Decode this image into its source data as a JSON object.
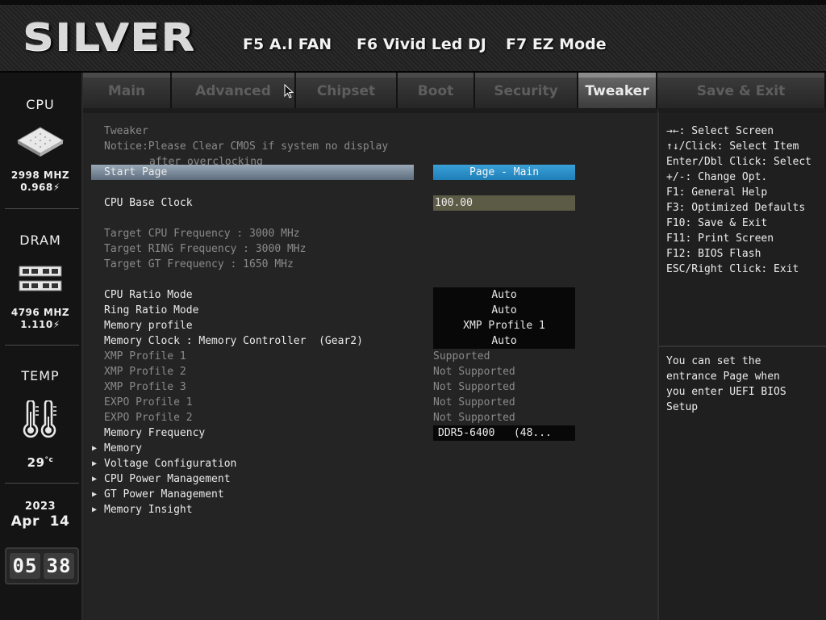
{
  "header": {
    "logo": "SILVER",
    "hotkeys": [
      {
        "label": "F5 A.I FAN"
      },
      {
        "label": "F6 Vivid Led DJ"
      },
      {
        "label": "F7 EZ Mode"
      }
    ]
  },
  "sidebar": {
    "cpu": {
      "title": "CPU",
      "freq": "2998 MHZ",
      "volt": "0.968",
      "icon": "cpu-chip-icon"
    },
    "dram": {
      "title": "DRAM",
      "freq": "4796 MHZ",
      "volt": "1.110",
      "icon": "dram-module-icon"
    },
    "temp": {
      "title": "TEMP",
      "value": "29",
      "icon": "thermometer-icon"
    },
    "date": {
      "year": "2023",
      "month_day": "Apr  14"
    },
    "clock": {
      "hours": "05",
      "minutes": "38"
    }
  },
  "tabs": [
    {
      "label": "Main",
      "active": false
    },
    {
      "label": "Advanced",
      "active": false
    },
    {
      "label": "Chipset",
      "active": false
    },
    {
      "label": "Boot",
      "active": false
    },
    {
      "label": "Security",
      "active": false
    },
    {
      "label": "Tweaker",
      "active": true
    },
    {
      "label": "Save & Exit",
      "active": false
    }
  ],
  "main": {
    "section_title": "Tweaker",
    "notice_line1": "Notice:Please Clear CMOS if system no display",
    "notice_line2": "after overclocking",
    "start_page": {
      "label": "Start Page",
      "value": "Page - Main"
    },
    "cpu_base_clock": {
      "label": "CPU Base Clock",
      "value": "100.00"
    },
    "targets": [
      "Target CPU Frequency : 3000 MHz",
      "Target RING Frequency : 3000 MHz",
      "Target GT Frequency : 1650 MHz"
    ],
    "settings": [
      {
        "label": "CPU Ratio Mode",
        "value": "Auto"
      },
      {
        "label": "Ring Ratio Mode",
        "value": "Auto"
      },
      {
        "label": "Memory profile",
        "value": "XMP Profile 1"
      },
      {
        "label": "Memory Clock : Memory Controller  (Gear2)",
        "value": "Auto"
      }
    ],
    "profiles": [
      {
        "label": "XMP Profile 1",
        "value": "Supported"
      },
      {
        "label": "XMP Profile 2",
        "value": "Not Supported"
      },
      {
        "label": "XMP Profile 3",
        "value": "Not Supported"
      },
      {
        "label": "EXPO Profile 1",
        "value": "Not Supported"
      },
      {
        "label": "EXPO Profile 2",
        "value": "Not Supported"
      }
    ],
    "memory_frequency": {
      "label": "Memory Frequency",
      "value": "DDR5-6400   (48..."
    },
    "submenus": [
      "Memory",
      "Voltage Configuration",
      "CPU Power Management",
      "GT Power Management",
      "Memory Insight"
    ]
  },
  "help": {
    "keys": [
      "→←: Select Screen",
      "↑↓/Click: Select Item",
      "Enter/Dbl Click: Select",
      "+/-: Change Opt.",
      "F1: General Help",
      "F3: Optimized Defaults",
      "F10: Save & Exit",
      "F11: Print Screen",
      "F12: BIOS Flash",
      "ESC/Right Click: Exit"
    ],
    "description": [
      "You can set the",
      "entrance Page when",
      "you enter UEFI BIOS",
      "Setup"
    ]
  },
  "colors": {
    "selected_bar": "#7f8e9e",
    "start_page_value": "#2a90c8",
    "base_clock_field": "#5b5b46",
    "active_tab": "#5a5a5a"
  }
}
